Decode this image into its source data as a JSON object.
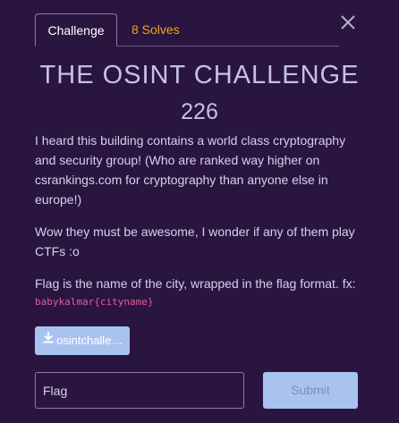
{
  "tabs": {
    "challenge_label": "Challenge",
    "solves_label": "8 Solves"
  },
  "challenge": {
    "title": "THE OSINT CHALLENGE",
    "points": "226",
    "description": [
      "I heard this building contains a world class cryptography and security group! (Who are ranked way higher on csrankings.com for cryptography than anyone else in europe!)",
      "Wow they must be awesome, I wonder if any of them play CTFs :o",
      "Flag is the name of the city, wrapped in the flag format. fx:"
    ],
    "flag_format": "babykalmar{cityname}",
    "attachment_label": "osintchalle…"
  },
  "form": {
    "flag_placeholder": "Flag",
    "submit_label": "Submit"
  },
  "icons": {
    "close": "close-icon",
    "download": "download-icon"
  },
  "colors": {
    "background": "#2a1540",
    "solves_accent": "#f0a41c",
    "code": "#e35c9a",
    "button": "#a9c3f0"
  }
}
